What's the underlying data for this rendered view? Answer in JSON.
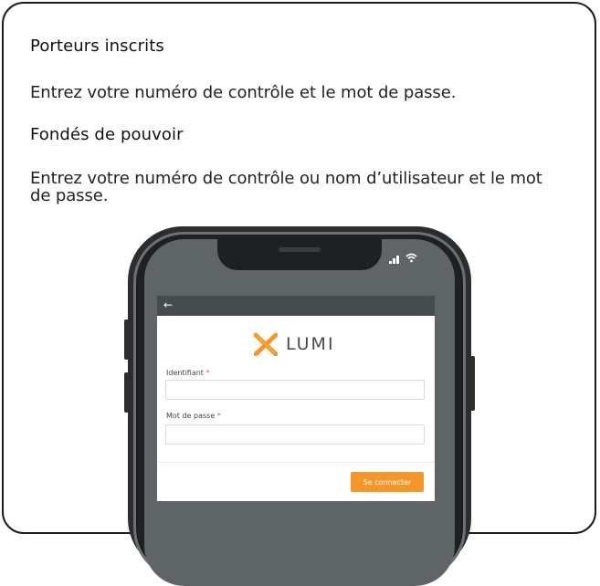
{
  "instructions": {
    "section1_title": "Porteurs inscrits",
    "section1_text": "Entrez votre numéro de contrôle et le mot de passe.",
    "section2_title": "Fondés de pouvoir",
    "section2_text": "Entrez votre numéro de contrôle ou nom d’utilisateur et le mot de passe."
  },
  "phone": {
    "app_bar": {
      "back_icon": "back-arrow-icon"
    },
    "logo": {
      "text": "LUMI",
      "brand_color": "#f4962a"
    },
    "form": {
      "username_label": "Identifiant",
      "username_value": "",
      "password_label": "Mot de passe",
      "password_value": "",
      "required_marker": "*",
      "submit_label": "Se connecter"
    },
    "status_icons": [
      "signal-icon",
      "wifi-icon"
    ]
  },
  "colors": {
    "accent": "#f4962a",
    "app_bar": "#454c4e",
    "screen_bg": "#5f6567"
  }
}
